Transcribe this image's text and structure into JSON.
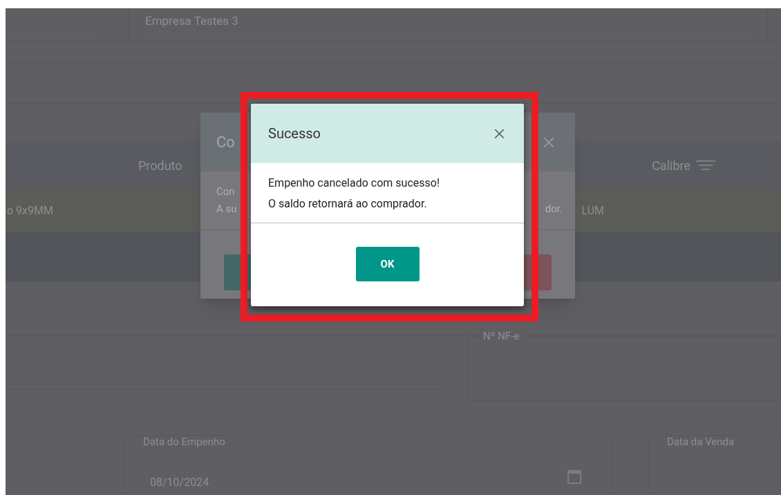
{
  "background_form": {
    "company_field": {
      "value": "Empresa Testes 3"
    },
    "table": {
      "columns": [
        {
          "label": "Produto",
          "filter": false
        },
        {
          "label": "Calibre",
          "filter": true
        }
      ],
      "rows": [
        {
          "cells": [
            "o 9x9MM",
            "LUM"
          ]
        }
      ]
    },
    "nfe_field": {
      "label": "Nº NF-e"
    },
    "pledge_date_field": {
      "label": "Data do Empenho",
      "value": "08/10/2024"
    },
    "sale_date_field": {
      "label": "Data da Venda"
    }
  },
  "confirm_dialog": {
    "title": "Co",
    "body_lines": [
      "Con",
      "A su"
    ],
    "body_tail": "dor.",
    "buttons": [
      {
        "kind": "confirm"
      },
      {
        "kind": "cancel"
      }
    ]
  },
  "success_dialog": {
    "title": "Sucesso",
    "message_lines": [
      "Empenho cancelado com sucesso!",
      "O saldo retornará ao comprador."
    ],
    "ok_button": "OK"
  }
}
